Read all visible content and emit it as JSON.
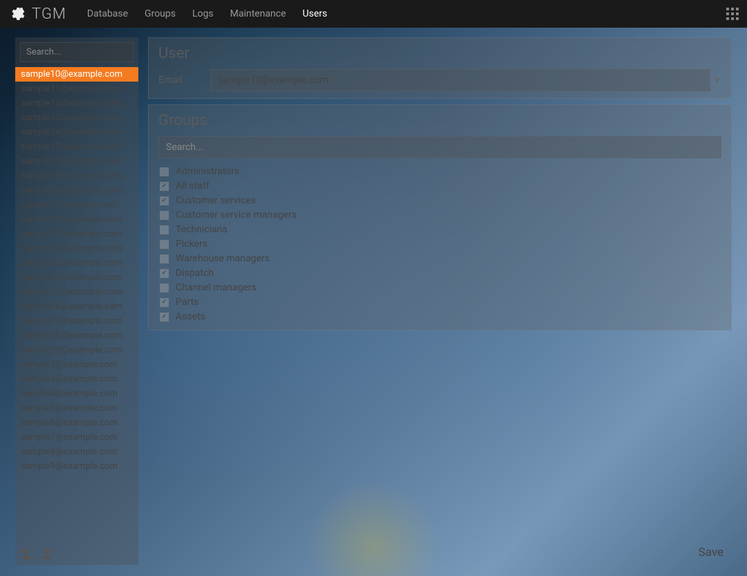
{
  "app": {
    "title": "TGM"
  },
  "nav": {
    "items": [
      {
        "label": "Database",
        "active": false
      },
      {
        "label": "Groups",
        "active": false
      },
      {
        "label": "Logs",
        "active": false
      },
      {
        "label": "Maintenance",
        "active": false
      },
      {
        "label": "Users",
        "active": true
      }
    ]
  },
  "sidebar": {
    "search_placeholder": "Search...",
    "users": [
      "sample10@example.com",
      "sample11@example.com",
      "sample12@example.com",
      "sample13@example.com",
      "sample14@example.com",
      "sample15@example.com",
      "sample17@example.com",
      "sample18@example.com",
      "sample19@example.com",
      "sample1@example.com",
      "sample20@example.com",
      "sample21@example.com",
      "sample22@example.com",
      "sample23@example.com",
      "sample24@example.com",
      "sample25@example.com",
      "sample26@example.com",
      "sample27@example.com",
      "sample28@example.com",
      "sample29@example.com",
      "sample2@example.com",
      "sample3@example.com",
      "sample4@example.com",
      "sample5@example.com",
      "sample6@example.com",
      "sample7@example.com",
      "sample8@example.com",
      "sample9@example.com"
    ],
    "selected_index": 0
  },
  "user_panel": {
    "title": "User",
    "email_label": "Email",
    "email_value": "sample10@example.com"
  },
  "groups_panel": {
    "title": "Groups",
    "search_placeholder": "Search...",
    "groups": [
      {
        "label": "Administrators",
        "checked": false
      },
      {
        "label": "All staff",
        "checked": true
      },
      {
        "label": "Customer services",
        "checked": true
      },
      {
        "label": "Customer service managers",
        "checked": false
      },
      {
        "label": "Technicians",
        "checked": false
      },
      {
        "label": "Pickers",
        "checked": false
      },
      {
        "label": "Warehouse managers",
        "checked": false
      },
      {
        "label": "Dispatch",
        "checked": true
      },
      {
        "label": "Channel managers",
        "checked": false
      },
      {
        "label": "Parts",
        "checked": true
      },
      {
        "label": "Assets",
        "checked": true
      }
    ]
  },
  "actions": {
    "save": "Save"
  }
}
